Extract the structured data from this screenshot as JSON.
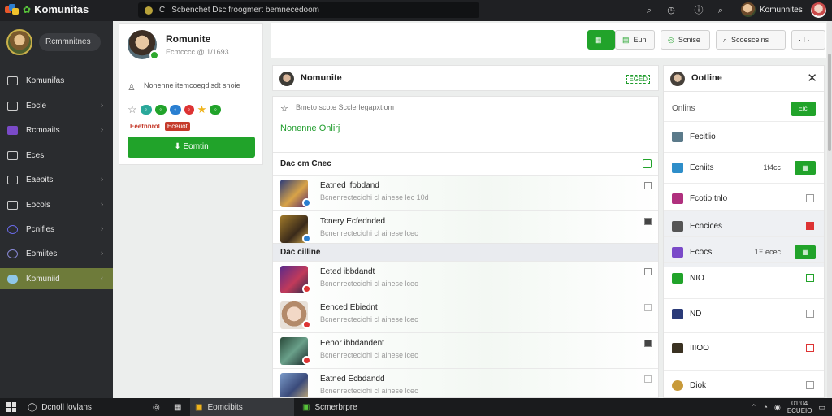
{
  "topbar": {
    "brand": "Komunitas",
    "address": "Scbenchet Dsc froogmert bemnecedoom",
    "prefix": "C",
    "icons": [
      "search-icon",
      "clock-icon",
      "info-icon",
      "search-icon"
    ],
    "user_name": "Komunnites"
  },
  "sidebar": {
    "user_label": "Rcmmnitnes",
    "items": [
      {
        "label": "Komunifas",
        "icon": "monitor-icon",
        "chevron": ""
      },
      {
        "label": "Eocle",
        "icon": "settings-icon",
        "chevron": "›"
      },
      {
        "label": "Rcmoaits",
        "icon": "twitch-icon",
        "chevron": "›"
      },
      {
        "label": "Eces",
        "icon": "card-icon",
        "chevron": ""
      },
      {
        "label": "Eaeoits",
        "icon": "grid-icon",
        "chevron": "›"
      },
      {
        "label": "Eocols",
        "icon": "lock-icon",
        "chevron": "›"
      },
      {
        "label": "Pcnifles",
        "icon": "circle-icon",
        "chevron": "›"
      },
      {
        "label": "Eomiites",
        "icon": "globe-icon",
        "chevron": "›"
      },
      {
        "label": "Komuniid",
        "icon": "cloud-icon",
        "chevron": "‹"
      }
    ]
  },
  "profile": {
    "name": "Romunite",
    "sub": "Ecmcccc @ 1/1693",
    "desc": "Nonenne itemcoegdisdt snoie",
    "tags": [
      "Eeetnnrol",
      "Eceuot"
    ],
    "button": "Eomtin"
  },
  "toolbar": {
    "buttons": [
      {
        "label": "",
        "style": "green"
      },
      {
        "label": "Eun",
        "style": "normal"
      },
      {
        "label": "Scnise",
        "style": "normal"
      },
      {
        "label": "Scoesceins",
        "style": "normal"
      },
      {
        "label": "· I ·",
        "style": "normal"
      }
    ]
  },
  "main": {
    "title": "Nomunite",
    "right_tag": "EGED",
    "compose_placeholder": "Bmeto scote Scclerlegapxtiom",
    "status": "Nonenne Onlirj",
    "section1": "Dac cm Cnec",
    "section2": "Dac cilline",
    "rows1": [
      {
        "title": "Eatned ifobdand",
        "sub": "Bcnenrecteciohi cl ainese lec 10d"
      },
      {
        "title": "Tcnery Ecfednded",
        "sub": "Bcnenrecteciohi cl ainese lcec"
      }
    ],
    "rows2": [
      {
        "title": "Eeted ibbdandt",
        "sub": "Bcnenrecteciohi cl ainese lcec"
      },
      {
        "title": "Eenced Ebiednt",
        "sub": "Bcnenrecteciohi cl ainese lcec"
      },
      {
        "title": "Eenor ibbdandent",
        "sub": "Bcnenrecteciohi cl ainese lcec"
      },
      {
        "title": "Eatned Ecbdandd",
        "sub": "Bcnenrecteciohi cl ainese lcec"
      }
    ]
  },
  "rpanel": {
    "title": "Ootline",
    "sub": "Onlins",
    "sub_btn": "Eicl",
    "rows": [
      {
        "label": "Fecitlio",
        "num": "",
        "ctrl": "none",
        "color": "#5b7a8a"
      },
      {
        "label": "Ecniits",
        "num": "1f4cc",
        "ctrl": "green",
        "color": "#2e8ec9"
      },
      {
        "label": "Fcotio tnlo",
        "num": "",
        "ctrl": "box",
        "color": "#b0307e"
      },
      {
        "label": "Ecncices",
        "num": "",
        "ctrl": "red",
        "color": "#555555"
      },
      {
        "label": "Ecocs",
        "num": "1Ξ ecec",
        "ctrl": "green",
        "color": "#7a4ac8"
      },
      {
        "label": "NIO",
        "num": "",
        "ctrl": "gbox",
        "color": "#21a32a"
      },
      {
        "label": "ND",
        "num": "",
        "ctrl": "box",
        "color": "#2a3a78"
      },
      {
        "label": "IIIOO",
        "num": "",
        "ctrl": "rbox",
        "color": "#3a3222"
      },
      {
        "label": "Diok",
        "num": "",
        "ctrl": "box",
        "color": "#c89a3a"
      }
    ]
  },
  "taskbar": {
    "search": "Dcnoll lovlans",
    "apps": [
      "Eomcibits",
      "Scmerbrpre"
    ],
    "time": "01:04",
    "date": "ECUEIO"
  }
}
